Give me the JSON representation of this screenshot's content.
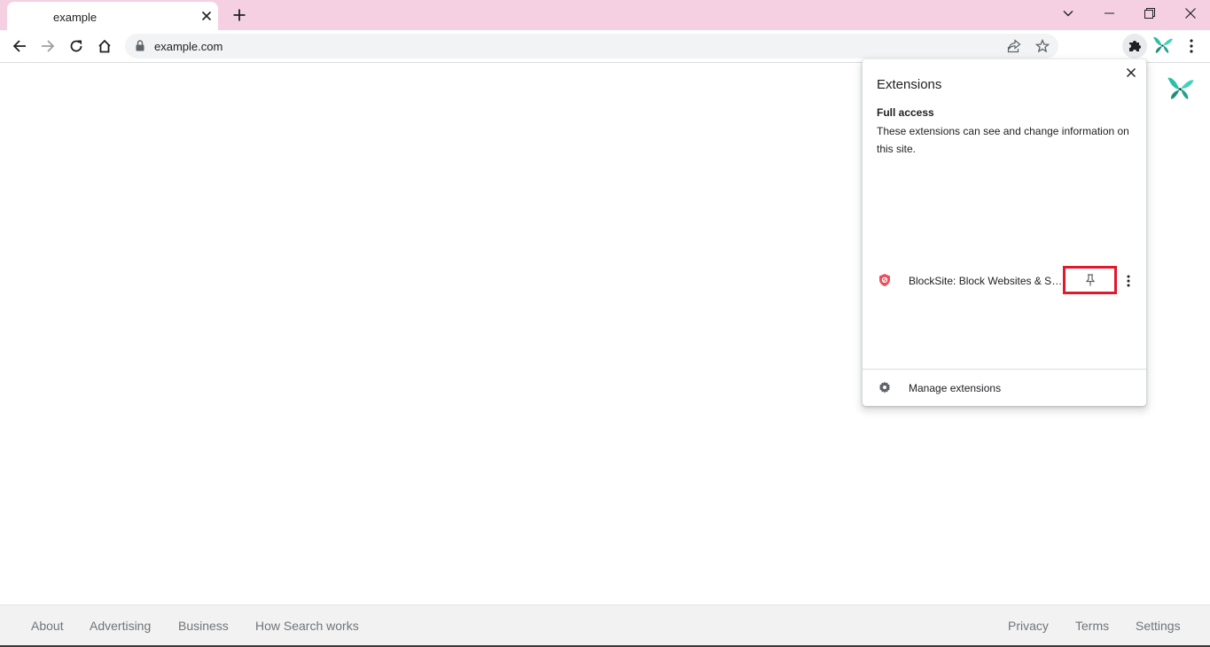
{
  "colors": {
    "frame": "#f4d0e2",
    "accent_red": "#e0192c",
    "butterfly_teal": "#2bbfa7"
  },
  "tab": {
    "title": "example",
    "close_icon": "close-icon",
    "new_tab_icon": "plus-icon"
  },
  "window_controls": {
    "tab_search_icon": "chevron-down-icon",
    "minimize_icon": "minimize-icon",
    "restore_icon": "restore-icon",
    "close_icon": "close-icon"
  },
  "toolbar": {
    "back_icon": "arrow-left-icon",
    "forward_icon": "arrow-right-icon",
    "reload_icon": "reload-icon",
    "home_icon": "home-icon",
    "url": "example.com",
    "lock_icon": "lock-icon",
    "share_icon": "share-icon",
    "bookmark_icon": "star-icon",
    "extensions_icon": "puzzle-icon",
    "menu_icon": "kebab-menu-icon"
  },
  "extensions_popup": {
    "title": "Extensions",
    "section_heading": "Full access",
    "section_description": "These extensions can see and change information on this site.",
    "extensions": [
      {
        "name": "BlockSite: Block Websites & Sta...",
        "icon": "blocksite-shield-icon",
        "pinned": false
      }
    ],
    "manage_label": "Manage extensions",
    "manage_icon": "gear-icon"
  },
  "footer": {
    "left_links": [
      "About",
      "Advertising",
      "Business",
      "How Search works"
    ],
    "right_links": [
      "Privacy",
      "Terms",
      "Settings"
    ]
  }
}
